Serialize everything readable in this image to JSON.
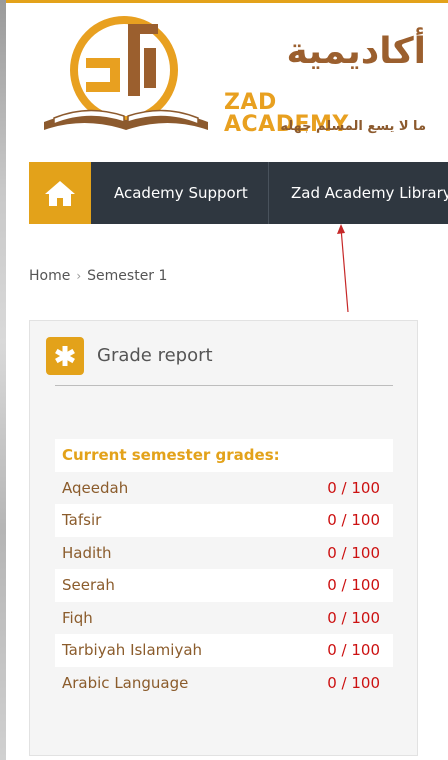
{
  "brand": {
    "name_ar": "أكاديمية",
    "name_en": "ZAD ACADEMY",
    "tagline_ar": "ما لا يسع المسلم جهله",
    "colors": {
      "gold": "#e3a21a",
      "brown": "#8b5c2c"
    }
  },
  "nav": {
    "home_icon": "home-icon",
    "items": [
      {
        "label": "Academy Support"
      },
      {
        "label": "Zad Academy Library"
      }
    ]
  },
  "breadcrumb": {
    "items": [
      {
        "label": "Home"
      },
      {
        "label": "Semester 1"
      }
    ],
    "separator": "›"
  },
  "grade_report": {
    "title": "Grade report",
    "icon": "asterisk-icon",
    "section_heading": "Current semester grades:",
    "rows": [
      {
        "subject": "Aqeedah",
        "score": "0 / 100"
      },
      {
        "subject": "Tafsir",
        "score": "0 / 100"
      },
      {
        "subject": "Hadith",
        "score": "0 / 100"
      },
      {
        "subject": "Seerah",
        "score": "0 / 100"
      },
      {
        "subject": "Fiqh",
        "score": "0 / 100"
      },
      {
        "subject": "Tarbiyah Islamiyah",
        "score": "0 / 100"
      },
      {
        "subject": "Arabic Language",
        "score": "0 / 100"
      }
    ]
  }
}
